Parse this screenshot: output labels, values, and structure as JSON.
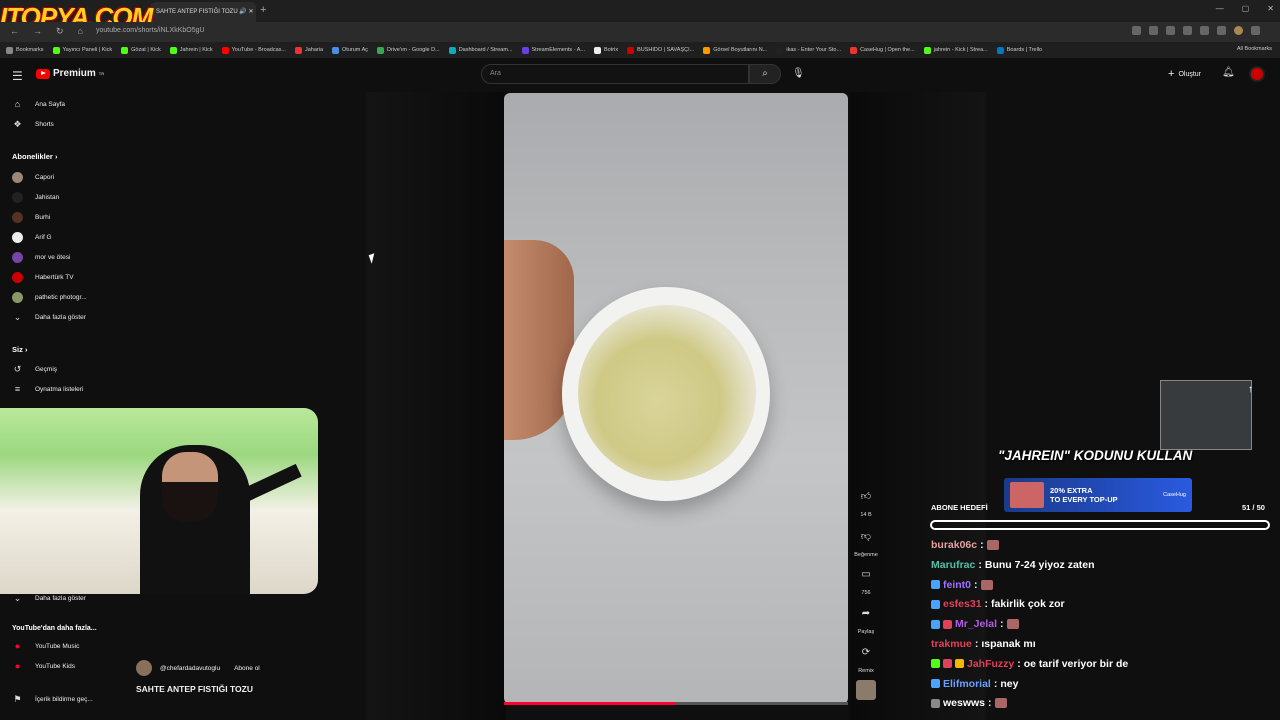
{
  "browser": {
    "watermark": "ITOPYA.COM",
    "tab_title": "SAHTE ANTEP FISTIĞI TOZU",
    "url": "youtube.com/shorts/iNLXkKbO5gU",
    "all_bookmarks": "All Bookmarks",
    "bookmarks": [
      {
        "label": "Bookmarks",
        "color": "#888"
      },
      {
        "label": "Yayıncı Paneli | Kick",
        "color": "#53fc18"
      },
      {
        "label": "Gözat | Kick",
        "color": "#53fc18"
      },
      {
        "label": "Jahrein | Kick",
        "color": "#53fc18"
      },
      {
        "label": "YouTube - Broadcas...",
        "color": "#ff0000"
      },
      {
        "label": "Jaharia",
        "color": "#e33"
      },
      {
        "label": "Oturum Aç",
        "color": "#4a90e2"
      },
      {
        "label": "Drive'ım - Google D...",
        "color": "#34a853"
      },
      {
        "label": "Dashboard / Stream...",
        "color": "#1ab"
      },
      {
        "label": "StreamElements - A...",
        "color": "#6b3fe0"
      },
      {
        "label": "Botrix",
        "color": "#eee"
      },
      {
        "label": "BUSHIDO | SAVAŞÇI...",
        "color": "#c00"
      },
      {
        "label": "Görsel Boyutlarını N...",
        "color": "#f90"
      },
      {
        "label": "ikas - Enter Your Sto...",
        "color": "#222"
      },
      {
        "label": "CaseHug | Open the...",
        "color": "#e33"
      },
      {
        "label": "jahrein - Kick | Strea...",
        "color": "#53fc18"
      },
      {
        "label": "Boards | Trello",
        "color": "#0079bf"
      }
    ]
  },
  "header": {
    "logo": "Premium",
    "logo_sup": "TR",
    "search_placeholder": "Ara",
    "create_label": "Oluştur"
  },
  "sidebar": {
    "home": "Ana Sayfa",
    "shorts": "Shorts",
    "subscriptions_heading": "Abonelikler",
    "subscriptions": [
      {
        "label": "Capori",
        "color": "#998877"
      },
      {
        "label": "Jahistan",
        "color": "#222"
      },
      {
        "label": "Burhi",
        "color": "#553322"
      },
      {
        "label": "Arif G",
        "color": "#eee"
      },
      {
        "label": "mor ve ötesi",
        "color": "#7744aa"
      },
      {
        "label": "Habertürk TV",
        "color": "#c00"
      },
      {
        "label": "pathetic photogr...",
        "color": "#889966"
      }
    ],
    "show_more": "Daha fazla göster",
    "you_heading": "Siz",
    "history": "Geçmiş",
    "playlists": "Oynatma listeleri",
    "show_more_2": "Daha fazla göster",
    "more_from_youtube": "YouTube'dan daha fazla...",
    "youtube_music": "YouTube Music",
    "youtube_kids": "YouTube Kids",
    "report": "İçerik bildirme geç..."
  },
  "video": {
    "channel": "@chefardadavutoglu",
    "subscribe": "Abone ol",
    "title": "SAHTE ANTEP FISTIĞI TOZU",
    "progress": 0.5,
    "likes": "14 B",
    "dislike_label": "Beğenme",
    "comments": "756",
    "share_label": "Paylaş",
    "remix_label": "Remix"
  },
  "overlay": {
    "promo_text": "\"JAHREIN\" KODUNU KULLAN",
    "banner_line1": "20% EXTRA",
    "banner_line2": "TO EVERY TOP-UP",
    "banner_brand": "CaseHug",
    "goal_label": "ABONE HEDEFİ",
    "goal_count": "51 / 50"
  },
  "chat": [
    {
      "user": "burak06c",
      "color": "#e6a0a0",
      "msg": "",
      "badges": []
    },
    {
      "user": "Marufrac",
      "color": "#4fc1a8",
      "msg": "Bunu 7-24 yiyoz zaten",
      "badges": []
    },
    {
      "user": "feint0",
      "color": "#a070ff",
      "msg": "",
      "badges": [
        "#4aa3ff"
      ]
    },
    {
      "user": "esfes31",
      "color": "#e0425a",
      "msg": "fakirlik çok zor",
      "badges": [
        "#4aa3ff"
      ]
    },
    {
      "user": "Mr_Jelal",
      "color": "#b45ae8",
      "msg": "",
      "badges": [
        "#4aa3ff",
        "#e0425a"
      ]
    },
    {
      "user": "trakmue",
      "color": "#e0425a",
      "msg": "ıspanak mı",
      "badges": []
    },
    {
      "user": "JahFuzzy",
      "color": "#e0425a",
      "msg": "oe tarif veriyor bir de",
      "badges": [
        "#53fc18",
        "#e0425a",
        "#f5b800"
      ]
    },
    {
      "user": "Elifmorial",
      "color": "#6aa0ff",
      "msg": "ney",
      "badges": [
        "#4aa3ff"
      ]
    },
    {
      "user": "weswws",
      "color": "#ffffff",
      "msg": "",
      "badges": [
        "#888"
      ]
    }
  ]
}
